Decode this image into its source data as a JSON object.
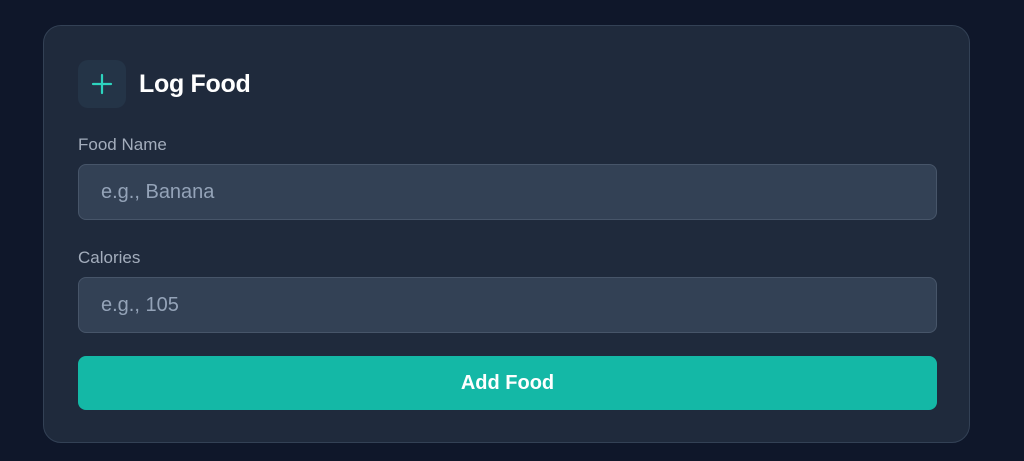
{
  "form": {
    "title": "Log Food",
    "header_icon": "plus-icon",
    "food_name": {
      "label": "Food Name",
      "placeholder": "e.g., Banana",
      "value": ""
    },
    "calories": {
      "label": "Calories",
      "placeholder": "e.g., 105",
      "value": ""
    },
    "submit_label": "Add Food"
  },
  "colors": {
    "background": "#0f172a",
    "card": "#1f2a3c",
    "input": "#334155",
    "accent": "#14b8a6"
  }
}
